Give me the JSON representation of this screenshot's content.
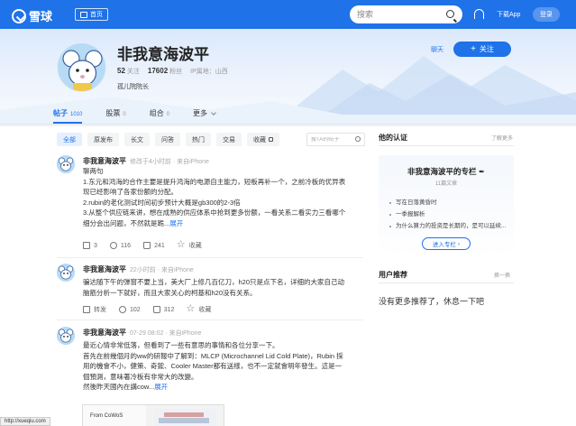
{
  "topbar": {
    "logo_text": "雪球",
    "home_label": "首页",
    "search_placeholder": "搜索",
    "download_label": "下载App",
    "login_label": "登录"
  },
  "profile": {
    "name": "非我意海波平",
    "stats": [
      {
        "num": "52",
        "label": "关注"
      },
      {
        "num": "17602",
        "label": "粉丝"
      },
      {
        "num": "",
        "label": "IP属地：山西"
      }
    ],
    "bio": "孤儿院院长",
    "chat_label": "聊天",
    "follow_label": "关注",
    "follow_plus": "+"
  },
  "tabs": [
    {
      "label": "帖子",
      "count": "1010",
      "active": true
    },
    {
      "label": "股票",
      "count": "0"
    },
    {
      "label": "组合",
      "count": "0"
    },
    {
      "label": "更多",
      "count": ""
    }
  ],
  "filters": [
    {
      "label": "全部",
      "active": true
    },
    {
      "label": "原发布"
    },
    {
      "label": "长文"
    },
    {
      "label": "问答"
    },
    {
      "label": "热门"
    },
    {
      "label": "交易"
    },
    {
      "label": "收藏"
    }
  ],
  "post_search_placeholder": "搜TA的帖子",
  "posts": [
    {
      "author": "非我意海波平",
      "meta": "修改于4小时前 · 来自iPhone",
      "lines": [
        "聊两句",
        "1.东元和鸿海的合作主要是提升鸿海的电源自主能力，短板再补一个，之前冷板的优异表",
        "现已经影响了各家份额的分配。",
        "2.rubin的老化测试时间初步预计大概是gb300的2-3倍",
        "3.从整个供应链来讲，想在成熟的供应体系中抢到更多份额，一看关系二看实力三看哪个",
        "细分会出问题，不然就是跪..."
      ],
      "more_label": "展开",
      "share": "3",
      "comment": "116",
      "like": "241",
      "fav": "收藏"
    },
    {
      "author": "非我意海波平",
      "meta": "22小时前 · 来自iPhone",
      "lines": [
        "骗达随下午的弹窗不要上当，美大厂上修几百亿刀，h20只是点下名，详细的大家自己动",
        "脑筋分析一下就好，而且大家关心的柯基和h20没有关系。"
      ],
      "more_label": "",
      "share": "转发",
      "comment": "102",
      "like": "312",
      "fav": "收藏"
    },
    {
      "author": "非我意海波平",
      "meta": "07-29 08:02 · 来自iPhone",
      "lines": [
        "最近心情非常低落，但看到了一些有意思的事情和各位分享一下。",
        "首先在前幾個月的ww的研報中了解到：MLCP (Microchannel Lid Cold Plate)，Rubin 採",
        "用的機會不小，健策、奇鋐、Cooler Master都有送樣，也不一定就會明年發生。這是一",
        "個預測，意味著冷板有非常大的改變。",
        "然後昨天國內在講cow..."
      ],
      "more_label": "展开",
      "thumb_caption": "From CoWoS"
    }
  ],
  "sidebar": {
    "cert_title": "他的认证",
    "cert_link": "了解更多",
    "column_title": "非我意海波平的专栏",
    "column_sub": "11篇文章",
    "column_items": [
      "写在日落黄昏时",
      "一季报解析",
      "为什么算力的投资是长期的，是可以延续..."
    ],
    "column_btn": "进入专栏",
    "rec_title": "用户推荐",
    "rec_link": "换一换",
    "rec_empty": "没有更多推荐了，休息一下吧"
  },
  "status_url": "http://xueqiu.com"
}
